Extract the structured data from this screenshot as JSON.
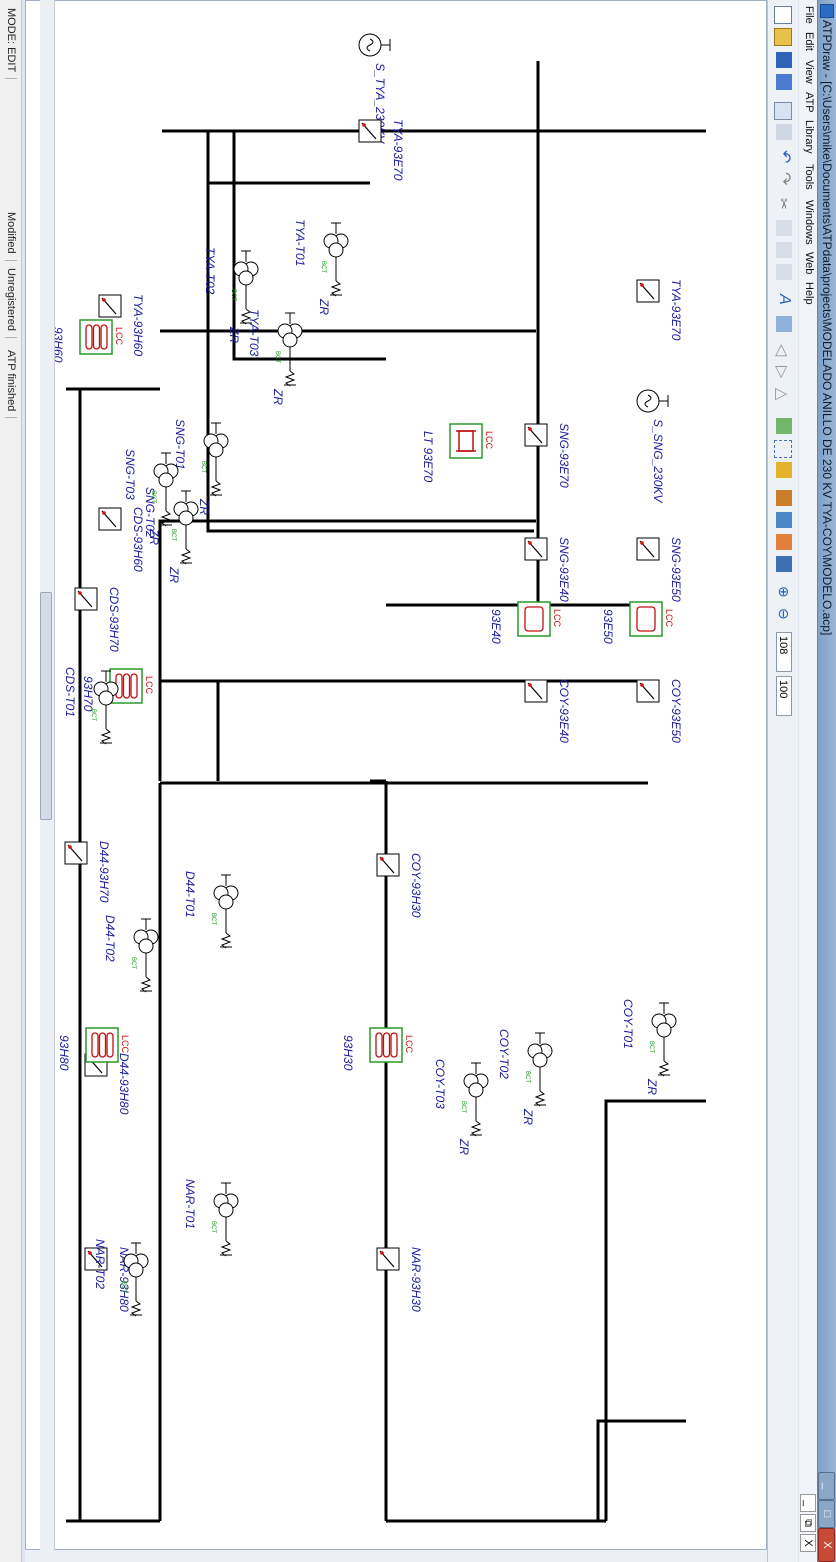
{
  "window": {
    "title": "ATPDraw - [C:\\Users\\mike\\Documents\\ATPdata\\projects\\MODELADO ANILLO DE 230 KV TYA-COY\\MODELO.acp]",
    "minimize_glyph": "_",
    "maximize_glyph": "□",
    "close_glyph": "X"
  },
  "menu": [
    "File",
    "Edit",
    "View",
    "ATP",
    "Library",
    "Tools",
    "Windows",
    "Web",
    "Help"
  ],
  "mdi_controls": [
    "_",
    "⧉",
    "X"
  ],
  "toolbar": {
    "zoom_value": "108",
    "zoom_step": "100"
  },
  "status": {
    "mode": "MODE: EDIT",
    "modified": "Modified",
    "registration": "Unregistered",
    "atp_state": "ATP finished"
  },
  "diagram": {
    "sources": [
      {
        "id": "src-tya",
        "label": "S_TYA_230KV"
      },
      {
        "id": "src-sng",
        "label": "S_SNG_230KV"
      }
    ],
    "switches": [
      {
        "id": "sw-tya-9370",
        "label": "TYA-93E70"
      },
      {
        "id": "sw-sng-9370",
        "label": "SNG-93E70"
      },
      {
        "id": "sw-sng-9350",
        "label": "SNG-93E50"
      },
      {
        "id": "sw-sng-9340",
        "label": "SNG-93E40"
      },
      {
        "id": "sw-coy-9350",
        "label": "COY-93E50"
      },
      {
        "id": "sw-coy-9340",
        "label": "COY-93E40"
      },
      {
        "id": "sw-tya-9360",
        "label": "TYA-93H60"
      },
      {
        "id": "sw-cds-9360",
        "label": "CDS-93H60"
      },
      {
        "id": "sw-cds-9370",
        "label": "CDS-93H70"
      },
      {
        "id": "sw-d44-9370",
        "label": "D44-93H70"
      },
      {
        "id": "sw-d44-9380",
        "label": "D44-93H80"
      },
      {
        "id": "sw-nar-9380",
        "label": "NAR-93H80"
      },
      {
        "id": "sw-coy-9330",
        "label": "COY-93H30"
      },
      {
        "id": "sw-nar-9330",
        "label": "NAR-93H30"
      }
    ],
    "lines": [
      {
        "id": "ln-9370",
        "label": "LT 93E70",
        "tag": "LCC"
      },
      {
        "id": "ln-9350",
        "label": "93E50",
        "tag": "LCC"
      },
      {
        "id": "ln-9340",
        "label": "93E40",
        "tag": "LCC"
      },
      {
        "id": "ln-9360",
        "label": "93H60",
        "tag": "LCC"
      },
      {
        "id": "ln-9370h",
        "label": "93H70",
        "tag": "LCC"
      },
      {
        "id": "ln-9380",
        "label": "93H80",
        "tag": "LCC"
      },
      {
        "id": "ln-9330",
        "label": "93H30",
        "tag": "LCC"
      }
    ],
    "transformers": [
      {
        "id": "tya-t01",
        "label": "TYA-T01",
        "res": "ZR"
      },
      {
        "id": "tya-t02",
        "label": "TYA-T02",
        "res": "ZR"
      },
      {
        "id": "tya-t03",
        "label": "TYA-T03",
        "res": "ZR"
      },
      {
        "id": "sng-t01",
        "label": "SNG-T01",
        "res": "ZR"
      },
      {
        "id": "sng-t02",
        "label": "SNG-T02",
        "res": "ZR"
      },
      {
        "id": "sng-t03",
        "label": "SNG-T03",
        "res": "ZR"
      },
      {
        "id": "coy-t01",
        "label": "COY-T01",
        "res": "ZR"
      },
      {
        "id": "coy-t02",
        "label": "COY-T02",
        "res": "ZR"
      },
      {
        "id": "coy-t03",
        "label": "COY-T03",
        "res": "ZR"
      },
      {
        "id": "cds-t01",
        "label": "CDS-T01",
        "res": ""
      },
      {
        "id": "d44-t01",
        "label": "D44-T01",
        "res": ""
      },
      {
        "id": "d44-t02",
        "label": "D44-T02",
        "res": ""
      },
      {
        "id": "nar-t01",
        "label": "NAR-T01",
        "res": ""
      },
      {
        "id": "nar-t02",
        "label": "NAR-T02",
        "res": ""
      }
    ],
    "bct_tag": "BCT"
  }
}
